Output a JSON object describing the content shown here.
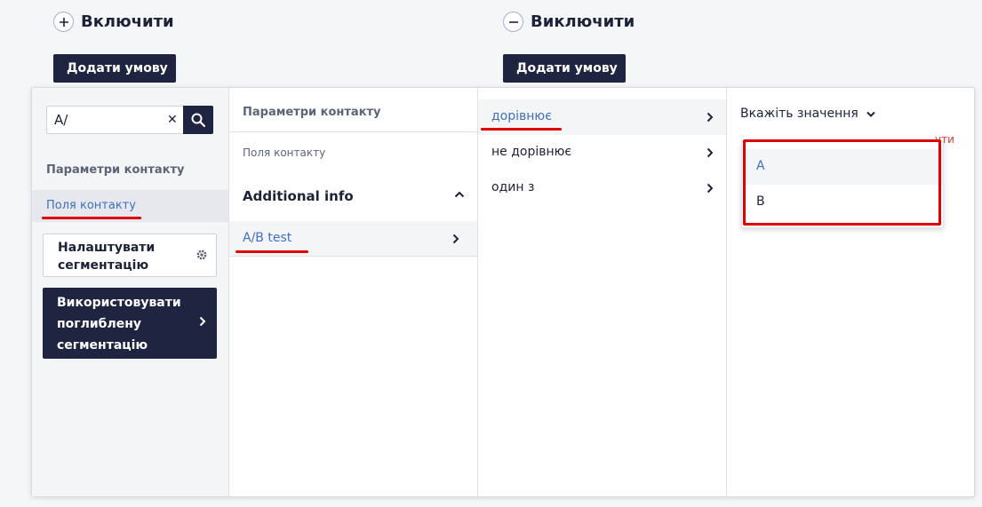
{
  "include": {
    "title": "Включити",
    "add_label": "Додати умову"
  },
  "exclude": {
    "title": "Виключити",
    "add_label": "Додати умову"
  },
  "search": {
    "value": "A/",
    "placeholder": ""
  },
  "col1": {
    "section_title": "Параметри контакту",
    "active_item": "Поля контакту",
    "configure_label": "Налаштувати сегментацію",
    "advanced_label": "Використовувати поглиблену сегментацію"
  },
  "col2": {
    "header": "Параметри контакту",
    "subheader": "Поля контакту",
    "group": "Additional info",
    "item": "A/B test"
  },
  "col3": {
    "operators": [
      {
        "label": "дорівнює"
      },
      {
        "label": "не дорівнює"
      },
      {
        "label": "один з"
      }
    ]
  },
  "col4": {
    "value_placeholder": "Вкажіть значення",
    "error_fragment": "ути",
    "options": [
      {
        "label": "A"
      },
      {
        "label": "B"
      }
    ]
  },
  "colors": {
    "dark": "#1f2540",
    "link": "#3f6fbf",
    "highlight_red": "#e00000"
  }
}
